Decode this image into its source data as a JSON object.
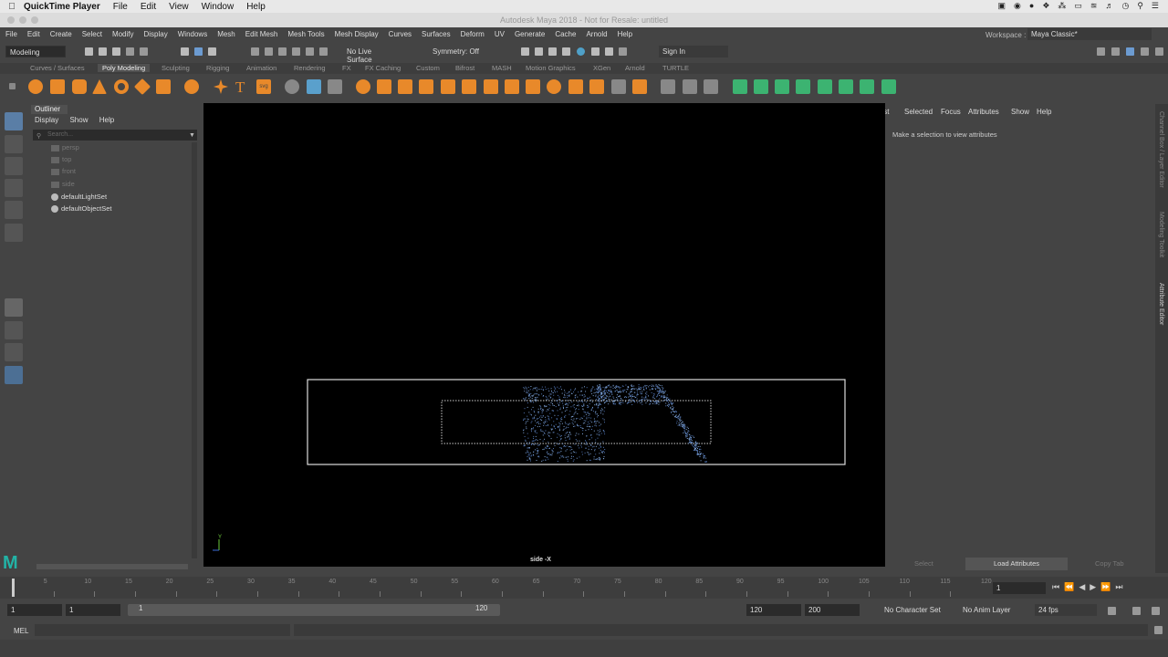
{
  "mac_menu": {
    "app": "QuickTime Player",
    "items": [
      "File",
      "Edit",
      "View",
      "Window",
      "Help"
    ]
  },
  "window_title": "Autodesk Maya 2018 - Not for Resale: untitled",
  "maya_menu": [
    "File",
    "Edit",
    "Create",
    "Select",
    "Modify",
    "Display",
    "Windows",
    "Mesh",
    "Edit Mesh",
    "Mesh Tools",
    "Mesh Display",
    "Curves",
    "Surfaces",
    "Deform",
    "UV",
    "Generate",
    "Cache",
    "Arnold",
    "Help"
  ],
  "workspace": {
    "label": "Workspace :",
    "value": "Maya Classic*"
  },
  "status_line": {
    "menuset": "Modeling",
    "live_surface": "No Live Surface",
    "symmetry": "Symmetry: Off",
    "sign_in": "Sign In"
  },
  "shelf_tabs": [
    "Curves / Surfaces",
    "Poly Modeling",
    "Sculpting",
    "Rigging",
    "Animation",
    "Rendering",
    "FX",
    "FX Caching",
    "Custom",
    "Bifrost",
    "MASH",
    "Motion Graphics",
    "XGen",
    "Arnold",
    "TURTLE"
  ],
  "shelf_active": "Poly Modeling",
  "outliner": {
    "tab": "Outliner",
    "menus": [
      "Display",
      "Show",
      "Help"
    ],
    "search_placeholder": "Search...",
    "items": [
      "persp",
      "top",
      "front",
      "side",
      "defaultLightSet",
      "defaultObjectSet"
    ]
  },
  "viewport": {
    "camera_label": "side -X",
    "axis_label": "Y"
  },
  "attribute_editor": {
    "menus": [
      "List",
      "Selected",
      "Focus",
      "Attributes",
      "Show",
      "Help"
    ],
    "message": "Make a selection to view attributes",
    "buttons": [
      "Select",
      "Load Attributes",
      "Copy Tab"
    ]
  },
  "side_tabs": [
    "Channel Box / Layer Editor",
    "Modeling Toolkit",
    "Attribute Editor"
  ],
  "timeline": {
    "ticks": [
      "1",
      "5",
      "10",
      "15",
      "20",
      "25",
      "30",
      "35",
      "40",
      "45",
      "50",
      "55",
      "60",
      "65",
      "70",
      "75",
      "80",
      "85",
      "90",
      "95",
      "100",
      "105",
      "110",
      "115",
      "120"
    ],
    "current_frame": "1"
  },
  "range": {
    "start": "1",
    "inner_start": "1",
    "slider_start": "1",
    "slider_end": "120",
    "end": "120",
    "outer_end": "200",
    "character_set": "No Character Set",
    "anim_layer": "No Anim Layer",
    "fps": "24 fps"
  },
  "command_line": {
    "label": "MEL"
  }
}
